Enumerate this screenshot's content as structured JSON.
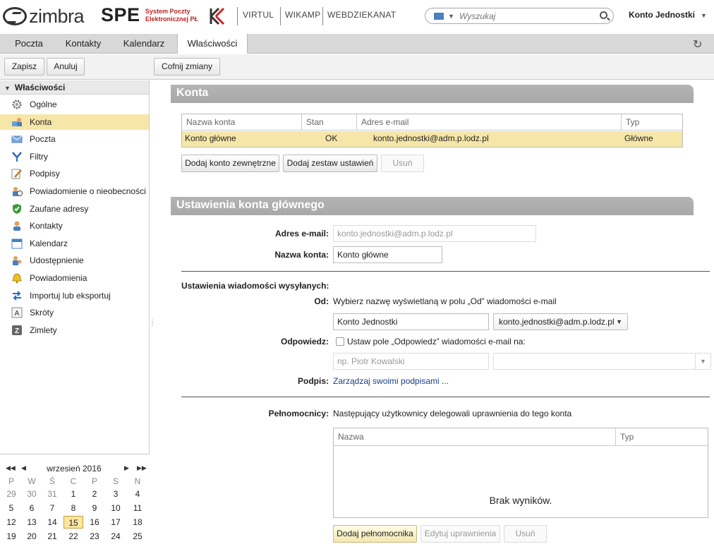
{
  "header": {
    "brand": "zimbra",
    "spe": "SPE",
    "spe_sub_line1": "System Poczty",
    "spe_sub_line2": "Elektronicznej PŁ",
    "links": [
      "VIRTUL",
      "WIKAMP",
      "WEBDZIEKANAT"
    ],
    "search_placeholder": "Wyszukaj",
    "user": "Konto Jednostki"
  },
  "tabs": [
    "Poczta",
    "Kontakty",
    "Kalendarz",
    "Właściwości"
  ],
  "toolbar": {
    "save": "Zapisz",
    "cancel": "Anuluj",
    "revert": "Cofnij zmiany"
  },
  "sidebar": {
    "title": "Właściwości",
    "items": [
      {
        "label": "Ogólne",
        "icon": "gear-icon"
      },
      {
        "label": "Konta",
        "icon": "accounts-icon"
      },
      {
        "label": "Poczta",
        "icon": "mail-icon"
      },
      {
        "label": "Filtry",
        "icon": "filter-icon"
      },
      {
        "label": "Podpisy",
        "icon": "signature-icon"
      },
      {
        "label": "Powiadomienie o nieobecności",
        "icon": "out-of-office-icon"
      },
      {
        "label": "Zaufane adresy",
        "icon": "shield-icon"
      },
      {
        "label": "Kontakty",
        "icon": "contact-icon"
      },
      {
        "label": "Kalendarz",
        "icon": "calendar-icon"
      },
      {
        "label": "Udostępnienie",
        "icon": "share-icon"
      },
      {
        "label": "Powiadomienia",
        "icon": "bell-icon"
      },
      {
        "label": "Importuj lub eksportuj",
        "icon": "import-export-icon"
      },
      {
        "label": "Skróty",
        "icon": "shortcut-icon"
      },
      {
        "label": "Zimlety",
        "icon": "zimlet-icon"
      }
    ],
    "selected": "Konta"
  },
  "calendar": {
    "month": "wrzesień 2016",
    "dow": [
      "P",
      "W",
      "Ś",
      "C",
      "P",
      "S",
      "N"
    ],
    "weeks": [
      [
        "29",
        "30",
        "31",
        "1",
        "2",
        "3",
        "4"
      ],
      [
        "5",
        "6",
        "7",
        "8",
        "9",
        "10",
        "11"
      ],
      [
        "12",
        "13",
        "14",
        "15",
        "16",
        "17",
        "18"
      ],
      [
        "19",
        "20",
        "21",
        "22",
        "23",
        "24",
        "25"
      ]
    ],
    "today": "15"
  },
  "accounts": {
    "title": "Konta",
    "columns": [
      "Nazwa konta",
      "Stan",
      "Adres e-mail",
      "Typ"
    ],
    "rows": [
      {
        "name": "Konto główne",
        "status": "OK",
        "email": "konto.jednostki@adm.p.lodz.pl",
        "type": "Główne"
      }
    ],
    "buttons": {
      "add_external": "Dodaj konto zewnętrzne",
      "add_persona": "Dodaj zestaw ustawień",
      "remove": "Usuń"
    }
  },
  "primary": {
    "title": "Ustawienia konta głównego",
    "email_label": "Adres e-mail:",
    "email_value": "konto.jednostki@adm.p.lodz.pl",
    "name_label": "Nazwa konta:",
    "name_value": "Konto główne",
    "sending_label": "Ustawienia wiadomości wysyłanych:",
    "from_label": "Od:",
    "from_desc": "Wybierz nazwę wyświetlaną w polu „Od” wiadomości e-mail",
    "from_name": "Konto Jednostki",
    "from_email": "konto.jednostki@adm.p.lodz.pl",
    "reply_label": "Odpowiedz:",
    "reply_desc": "Ustaw pole „Odpowiedz” wiadomości e-mail na:",
    "reply_placeholder": "np. Piotr Kowalski",
    "signature_label": "Podpis:",
    "signature_link": "Zarządzaj swoimi podpisami ...",
    "delegates_label": "Pełnomocnicy:",
    "delegates_desc": "Następujący użytkownicy delegowali uprawnienia do tego konta",
    "delegates_columns": [
      "Nazwa",
      "Typ"
    ],
    "no_results": "Brak wyników.",
    "buttons": {
      "add": "Dodaj pełnomocnika",
      "edit": "Edytuj uprawnienia",
      "remove": "Usuń"
    }
  }
}
